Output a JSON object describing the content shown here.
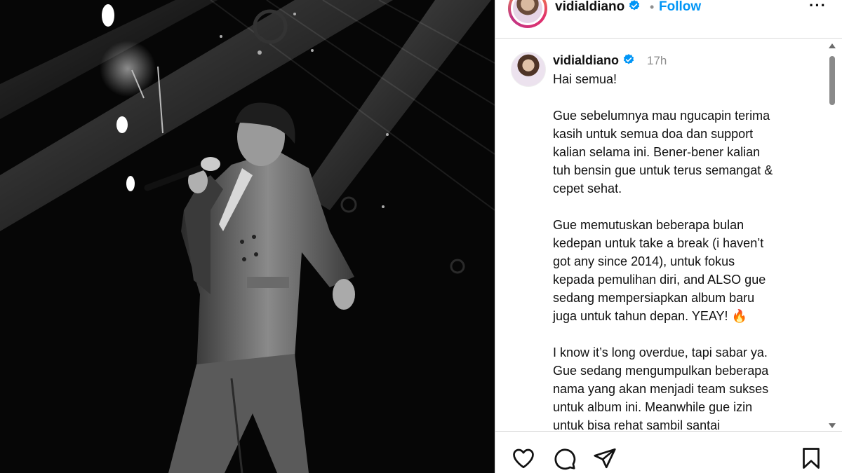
{
  "post": {
    "username": "vidialdiano",
    "follow_label": "Follow",
    "separator": "•",
    "more_label": "···"
  },
  "comment": {
    "username": "vidialdiano",
    "time": "17h",
    "paragraphs": [
      "Hai semua!",
      "Gue sebelumnya mau ngucapin terima\nkasih untuk semua doa dan support\nkalian selama ini. Bener-bener kalian\ntuh bensin gue untuk terus semangat &\ncepet sehat.",
      "Gue memutuskan beberapa bulan\nkedepan untuk take a break (i haven’t\ngot any since 2014), untuk fokus\nkepada pemulihan diri, and ALSO gue\nsedang mempersiapkan album baru\njuga untuk tahun depan. YEAY!",
      "I know it’s long overdue, tapi sabar ya.\nGue sedang mengumpulkan beberapa\nnama yang akan menjadi team sukses\nuntuk album ini. Meanwhile gue izin\nuntuk bisa rehat sambil santai"
    ],
    "emoji": "🔥"
  },
  "icons": {
    "verified": "verified-badge-icon",
    "like": "heart-icon",
    "comment": "comment-bubble-icon",
    "share": "send-icon",
    "save": "bookmark-icon"
  },
  "colors": {
    "link": "#0095f6",
    "verified": "#0095f6",
    "border": "#dbdbdb",
    "muted": "#8e8e8e"
  }
}
